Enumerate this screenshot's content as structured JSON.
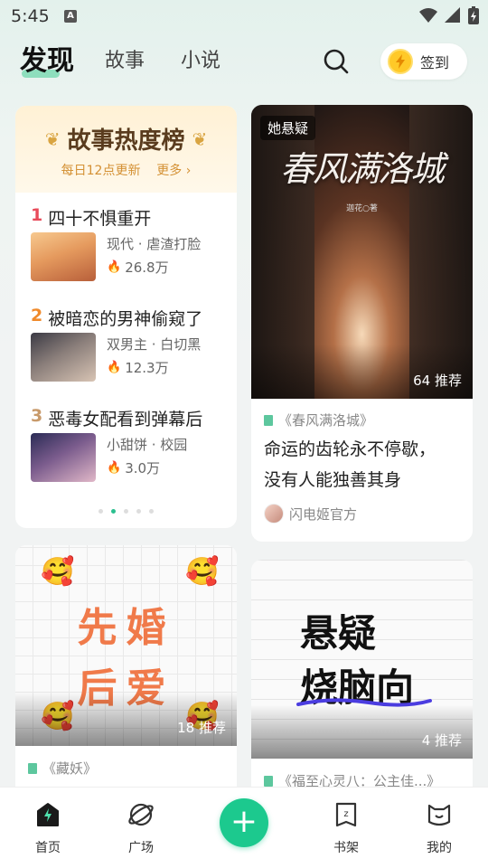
{
  "status": {
    "time": "5:45",
    "notif_icon": "A"
  },
  "header": {
    "tabs": [
      {
        "label": "发现"
      },
      {
        "label": "故事"
      },
      {
        "label": "小说"
      }
    ],
    "signin_label": "签到"
  },
  "ranking": {
    "title": "故事热度榜",
    "subtitle": "每日12点更新",
    "more": "更多 ›",
    "items": [
      {
        "num": "1",
        "title": "四十不惧重开",
        "tags": "现代 · 虐渣打脸",
        "heat": "26.8万",
        "num_color": "#e84b5a"
      },
      {
        "num": "2",
        "title": "被暗恋的男神偷窥了",
        "tags": "双男主 · 白切黑",
        "heat": "12.3万",
        "num_color": "#f08a2b"
      },
      {
        "num": "3",
        "title": "恶毒女配看到弹幕后",
        "tags": "小甜饼 · 校园",
        "heat": "3.0万",
        "num_color": "#c89a6b"
      }
    ]
  },
  "book1": {
    "cover_tag": "她悬疑",
    "cover_title": "春风满洛城",
    "cover_author": "迦花○著",
    "recommend": "64 推荐",
    "name": "《春风满洛城》",
    "desc_line1": "命运的齿轮永不停歇，",
    "desc_line2": "没有人能独善其身",
    "author": "闪电姬官方"
  },
  "book2": {
    "cover_line1": "先婚",
    "cover_line2": "后爱",
    "recommend": "18 推荐",
    "name": "《藏妖》"
  },
  "book3": {
    "cover_line1": "悬疑",
    "cover_line2": "烧脑向",
    "recommend": "4 推荐",
    "name": "《福至心灵八：公主佳...》"
  },
  "nav": {
    "items": [
      {
        "label": "首页"
      },
      {
        "label": "广场"
      },
      {
        "label": "书架"
      },
      {
        "label": "我的"
      }
    ],
    "fab": "+"
  },
  "colors": {
    "accent": "#1cc98e",
    "heat": "#f06a7d"
  }
}
